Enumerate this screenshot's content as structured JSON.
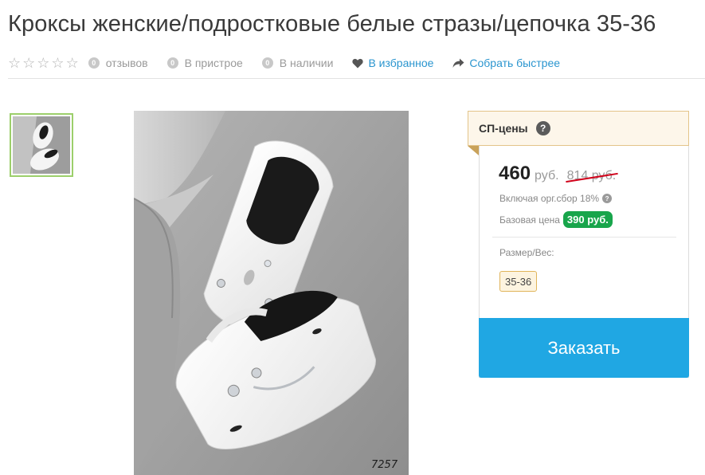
{
  "product": {
    "title": "Кроксы женские/подростковые белые стразы/цепочка 35-36"
  },
  "meta": {
    "reviews_count": "0",
    "reviews_label": "отзывов",
    "attach_count": "0",
    "attach_label": "В пристрое",
    "stock_count": "0",
    "stock_label": "В наличии",
    "favorite_label": "В избранное",
    "collect_label": "Собрать быстрее"
  },
  "gallery": {
    "photo_code": "7257"
  },
  "pricing": {
    "header": "СП-цены",
    "header_help": "?",
    "price": "460",
    "currency": "руб.",
    "old_price": "814 руб.",
    "fee_note": "Включая орг.сбор 18%",
    "fee_help": "?",
    "base_label": "Базовая цена",
    "base_price": "390 руб.",
    "size_label": "Размер/Вес:",
    "size_value": "35-36",
    "order_label": "Заказать"
  },
  "colors": {
    "accent_link": "#2a95cf",
    "order_button": "#20a7e3",
    "base_badge": "#18a54b",
    "strike": "#d0021b",
    "header_border": "#e3c48a",
    "thumb_border": "#9ccf6b"
  },
  "icons": {
    "stars": "star-outline-icon",
    "heart": "heart-icon",
    "share": "share-arrow-icon"
  }
}
